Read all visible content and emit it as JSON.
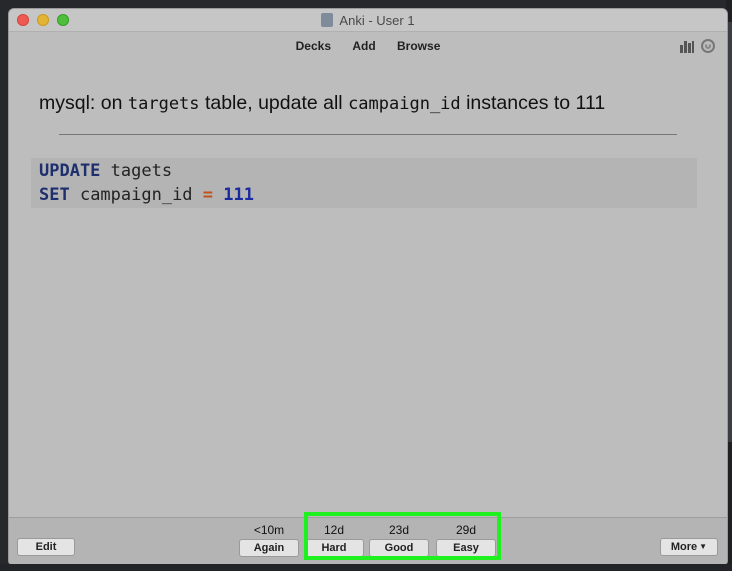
{
  "window": {
    "title": "Anki - User 1"
  },
  "toolbar": {
    "decks": "Decks",
    "add": "Add",
    "browse": "Browse"
  },
  "card": {
    "question_prefix": "mysql: on ",
    "question_code1": "targets",
    "question_mid": " table, update all ",
    "question_code2": "campaign_id",
    "question_suffix": " instances to 111",
    "code": {
      "line1_kw": "UPDATE",
      "line1_rest": " tagets",
      "line2_kw": "SET",
      "line2_mid": " campaign_id ",
      "line2_op": "=",
      "line2_sp": " ",
      "line2_num": "111"
    }
  },
  "bottom": {
    "edit": "Edit",
    "more": "More",
    "answers": [
      {
        "interval": "<10m",
        "label": "Again"
      },
      {
        "interval": "12d",
        "label": "Hard"
      },
      {
        "interval": "23d",
        "label": "Good"
      },
      {
        "interval": "29d",
        "label": "Easy"
      }
    ]
  },
  "colors": {
    "highlight": "#1ff01f"
  }
}
